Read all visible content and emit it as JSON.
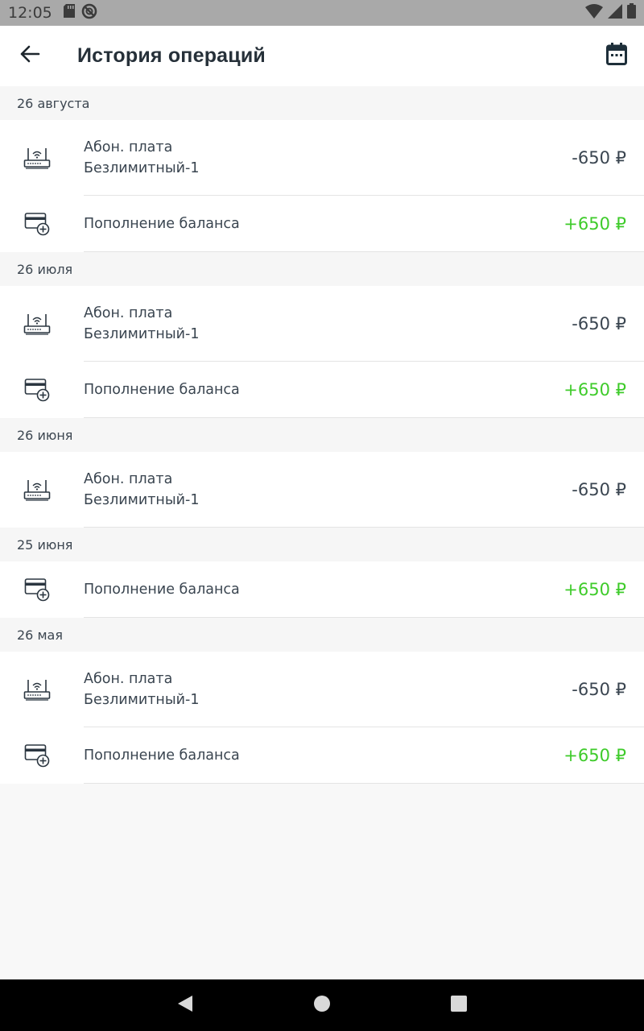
{
  "status_bar": {
    "time": "12:05",
    "icons": [
      "sd-card-icon",
      "sync-disabled-icon",
      "wifi-icon",
      "cellular-signal-icon",
      "battery-icon"
    ]
  },
  "header": {
    "title": "История операций",
    "back_icon": "arrow-left-icon",
    "calendar_icon": "calendar-icon"
  },
  "groups": [
    {
      "date": "26 августа",
      "operations": [
        {
          "type": "fee",
          "icon": "router-icon",
          "line1": "Абон. плата",
          "line2": "Безлимитный-1",
          "amount": "-650 ₽"
        },
        {
          "type": "topup",
          "icon": "card-add-icon",
          "line1": "Пополнение баланса",
          "line2": "",
          "amount": "+650 ₽"
        }
      ]
    },
    {
      "date": "26 июля",
      "operations": [
        {
          "type": "fee",
          "icon": "router-icon",
          "line1": "Абон. плата",
          "line2": "Безлимитный-1",
          "amount": "-650 ₽"
        },
        {
          "type": "topup",
          "icon": "card-add-icon",
          "line1": "Пополнение баланса",
          "line2": "",
          "amount": "+650 ₽"
        }
      ]
    },
    {
      "date": "26 июня",
      "operations": [
        {
          "type": "fee",
          "icon": "router-icon",
          "line1": "Абон. плата",
          "line2": "Безлимитный-1",
          "amount": "-650 ₽"
        }
      ]
    },
    {
      "date": "25 июня",
      "operations": [
        {
          "type": "topup",
          "icon": "card-add-icon",
          "line1": "Пополнение баланса",
          "line2": "",
          "amount": "+650 ₽"
        }
      ]
    },
    {
      "date": "26 мая",
      "operations": [
        {
          "type": "fee",
          "icon": "router-icon",
          "line1": "Абон. плата",
          "line2": "Безлимитный-1",
          "amount": "-650 ₽"
        },
        {
          "type": "topup",
          "icon": "card-add-icon",
          "line1": "Пополнение баланса",
          "line2": "",
          "amount": "+650 ₽"
        }
      ]
    }
  ],
  "colors": {
    "positive": "#3ecb2a",
    "negative": "#3a4550",
    "status_bar": "#a9a9a9",
    "nav_bar": "#000000"
  },
  "nav_bar": {
    "buttons": [
      "back-triangle-icon",
      "home-circle-icon",
      "recents-square-icon"
    ]
  }
}
